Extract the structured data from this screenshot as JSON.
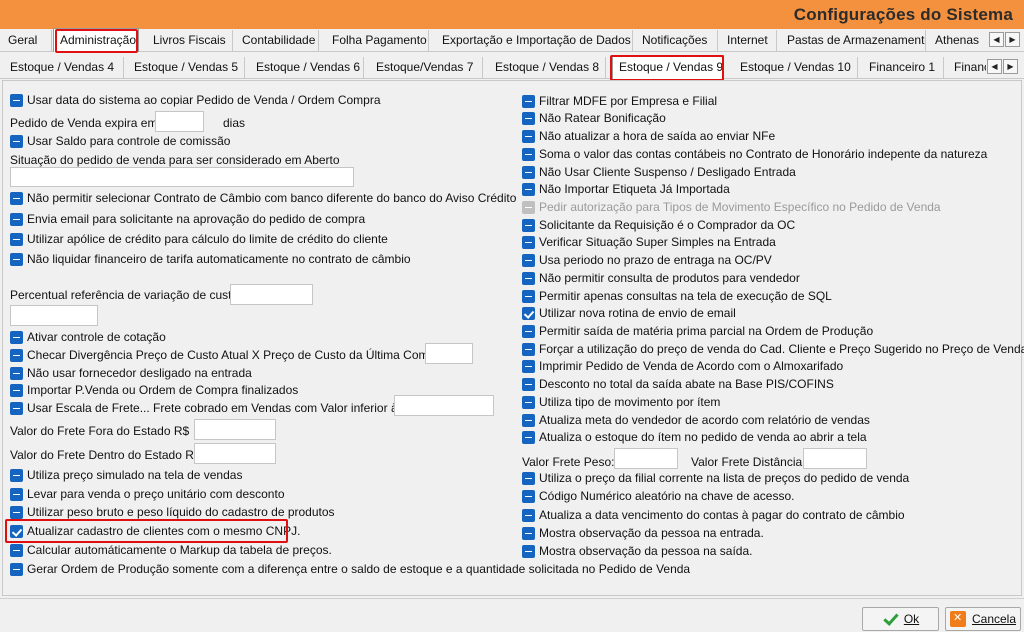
{
  "window": {
    "title": "Configurações do Sistema"
  },
  "tabs_row1": [
    {
      "label": "Geral"
    },
    {
      "label": "Administração"
    },
    {
      "label": "Livros Fiscais"
    },
    {
      "label": "Contabilidade"
    },
    {
      "label": "Folha Pagamento"
    },
    {
      "label": "Exportação e Importação de Dados"
    },
    {
      "label": "Notificações"
    },
    {
      "label": "Internet"
    },
    {
      "label": "Pastas de Armazenamento"
    },
    {
      "label": "Athenas"
    }
  ],
  "tabs_row2": [
    {
      "label": "Estoque / Vendas 4"
    },
    {
      "label": "Estoque / Vendas 5"
    },
    {
      "label": "Estoque / Vendas 6"
    },
    {
      "label": "Estoque/Vendas 7"
    },
    {
      "label": "Estoque / Vendas 8"
    },
    {
      "label": "Estoque / Vendas 9"
    },
    {
      "label": "Estoque / Vendas 10"
    },
    {
      "label": "Financeiro 1"
    },
    {
      "label": "Finance"
    }
  ],
  "left": {
    "opt1": "Usar data do sistema ao copiar Pedido de Venda / Ordem Compra",
    "pedido_expira_label": "Pedido de Venda expira em",
    "pedido_expira_suffix": "dias",
    "opt2": "Usar Saldo para controle de comissão",
    "situacao_label": "Situação do pedido de venda para ser considerado em Aberto",
    "opt3": "Não permitir selecionar Contrato de Câmbio com banco diferente do banco do Aviso Crédito",
    "opt4": "Envia email para solicitante na aprovação do pedido de compra",
    "opt5": "Utilizar apólice de crédito para cálculo do limite de crédito do cliente",
    "opt6": "Não liquidar financeiro de tarifa automaticamente no contrato de câmbio",
    "percentual_label": "Percentual referência de variação de custo",
    "opt7": "Ativar controle de cotação",
    "opt8": "Checar Divergência Preço de Custo Atual X Preço de Custo da Última Compra:",
    "opt9": "Não usar fornecedor desligado na entrada",
    "opt10": "Importar P.Venda ou Ordem de Compra finalizados",
    "opt11": "Usar Escala de Frete... Frete cobrado em Vendas com Valor inferior à R$",
    "frete_fora_label": "Valor do Frete Fora do Estado R$",
    "frete_dentro_label": "Valor do Frete Dentro do Estado R$",
    "opt12": "Utiliza preço simulado na tela de vendas",
    "opt13": "Levar para venda o preço unitário com desconto",
    "opt14": "Utilizar peso bruto e peso líquido do cadastro de produtos",
    "opt15": "Atualizar cadastro de clientes com o mesmo CNPJ.",
    "opt16": "Calcular automáticamente o Markup da tabela de preços.",
    "opt17": "Gerar Ordem de Produção somente com a diferença entre o saldo de estoque e a quantidade solicitada no Pedido de Venda"
  },
  "right": {
    "r1": "Filtrar MDFE por Empresa e Filial",
    "r2": "Não Ratear Bonificação",
    "r3": "Não atualizar a hora de saída ao enviar NFe",
    "r4": "Soma o valor das contas contábeis no Contrato de Honorário indepente da natureza",
    "r5": "Não Usar Cliente Suspenso / Desligado Entrada",
    "r6": "Não Importar Etiqueta Já Importada",
    "r7": "Pedir autorização para Tipos de Movimento Específico no Pedido de Venda",
    "r8": "Solicitante da Requisição é o Comprador da OC",
    "r9": "Verificar Situação Super Simples na Entrada",
    "r10": "Usa periodo no prazo de entraga na OC/PV",
    "r11": "Não permitir consulta de produtos para vendedor",
    "r12": "Permitir apenas consultas na tela de execução de SQL",
    "r13": "Utilizar nova rotina de envio de email",
    "r14": "Permitir saída de matéria prima parcial na Ordem de Produção",
    "r15": "Forçar a utilização do preço de venda do Cad. Cliente e Preço Sugerido no Preço de Venda",
    "r16": "Imprimir Pedido de Venda de Acordo com o Almoxarifado",
    "r17": "Desconto no total da saída abate na Base PIS/COFINS",
    "r18": "Utiliza tipo de movimento por ítem",
    "r19": "Atualiza meta do vendedor de acordo com relatório de vendas",
    "r20": "Atualiza o estoque do ítem no pedido de venda ao abrir a tela",
    "valor_frete_peso_label": "Valor Frete Peso:",
    "valor_frete_dist_label": "Valor Frete Distância:",
    "r21": "Utiliza o preço da filial corrente na lista de preços do pedido de venda",
    "r22": "Código Numérico aleatório na chave de acesso.",
    "r23": "Atualiza a data vencimento do contas à pagar do contrato de câmbio",
    "r24": "Mostra observação da pessoa na entrada.",
    "r25": "Mostra observação da pessoa na saída."
  },
  "buttons": {
    "ok": "Ok",
    "cancel": "Cancela"
  },
  "colors": {
    "titlebar": "#f3913f",
    "checkbox": "#1565c0",
    "highlight": "#e01010"
  }
}
